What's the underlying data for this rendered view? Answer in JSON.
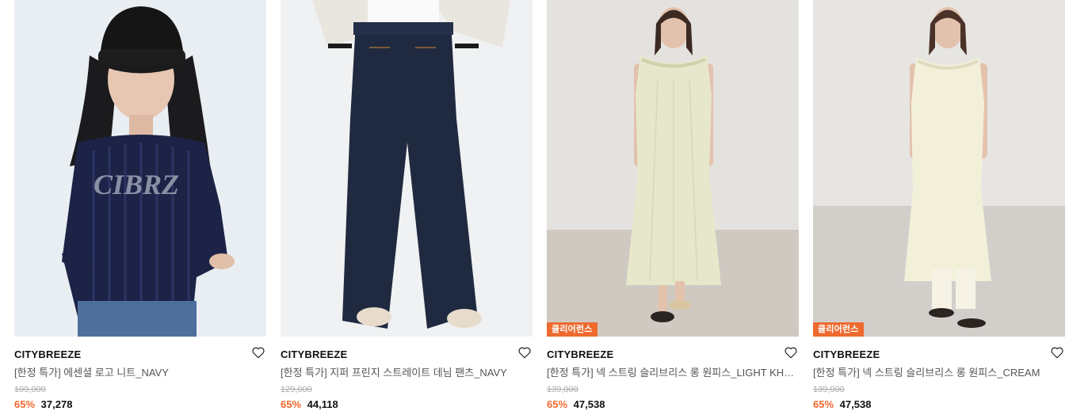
{
  "colors": {
    "accent": "#ef6a2e",
    "text_primary": "#111111",
    "text_secondary": "#555555",
    "text_muted": "#aaaaaa"
  },
  "products": [
    {
      "brand": "CITYBREEZE",
      "title": "[한정 특가] 에센셜 로고 니트_NAVY",
      "original_price": "109,000",
      "discount": "65%",
      "sale_price": "37,278",
      "badge": "",
      "wishlist_icon": "heart-outline-icon"
    },
    {
      "brand": "CITYBREEZE",
      "title": "[한정 특가] 지퍼 프린지 스트레이트 데님 팬츠_NAVY",
      "original_price": "129,000",
      "discount": "65%",
      "sale_price": "44,118",
      "badge": "",
      "wishlist_icon": "heart-outline-icon"
    },
    {
      "brand": "CITYBREEZE",
      "title": "[한정 특가] 넥 스트링 슬리브리스 롱 원피스_LIGHT KHAKI",
      "original_price": "139,000",
      "discount": "65%",
      "sale_price": "47,538",
      "badge": "클리어런스",
      "wishlist_icon": "heart-outline-icon"
    },
    {
      "brand": "CITYBREEZE",
      "title": "[한정 특가] 넥 스트링 슬리브리스 롱 원피스_CREAM",
      "original_price": "139,000",
      "discount": "65%",
      "sale_price": "47,538",
      "badge": "클리어런스",
      "wishlist_icon": "heart-outline-icon"
    }
  ]
}
